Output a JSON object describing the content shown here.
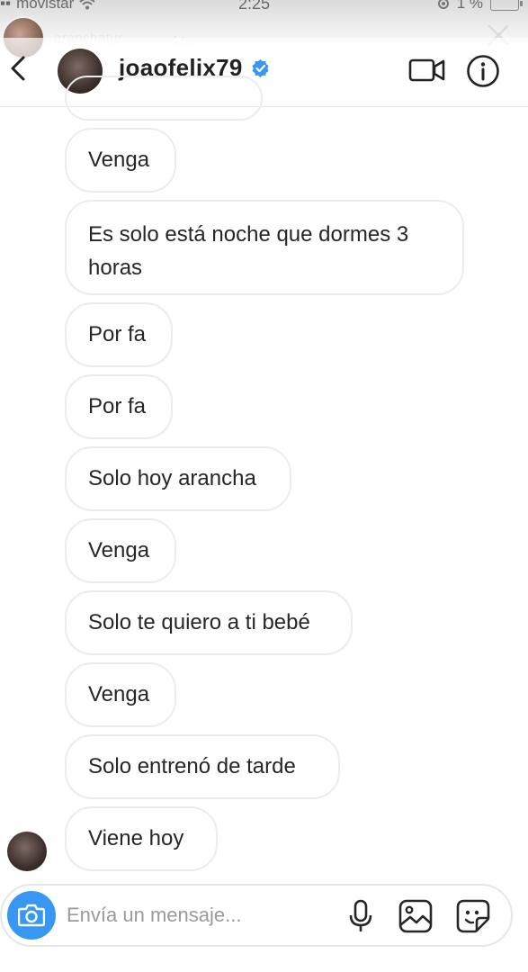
{
  "status_bar": {
    "carrier": "movistar",
    "time": "2:25",
    "battery": "1 %"
  },
  "story_overlay": {
    "username": "aranchatur",
    "time": "4 h"
  },
  "header": {
    "username": "joaofelix79",
    "verified": true
  },
  "messages": [
    "Venga",
    "Es solo está noche que dormes 3 horas",
    "Por fa",
    "Por fa",
    "Solo hoy arancha",
    "Venga",
    "Solo te quiero a ti bebé",
    "Venga",
    "Solo entrenó de tarde",
    "Viene hoy"
  ],
  "composer": {
    "placeholder": "Envía un mensaje..."
  },
  "colors": {
    "accent": "#3897f0",
    "bubble_border": "#ececec",
    "text": "#262626"
  },
  "icons": [
    "back-arrow-icon",
    "verified-badge-icon",
    "video-call-icon",
    "info-icon",
    "camera-icon",
    "microphone-icon",
    "gallery-icon",
    "sticker-icon"
  ]
}
